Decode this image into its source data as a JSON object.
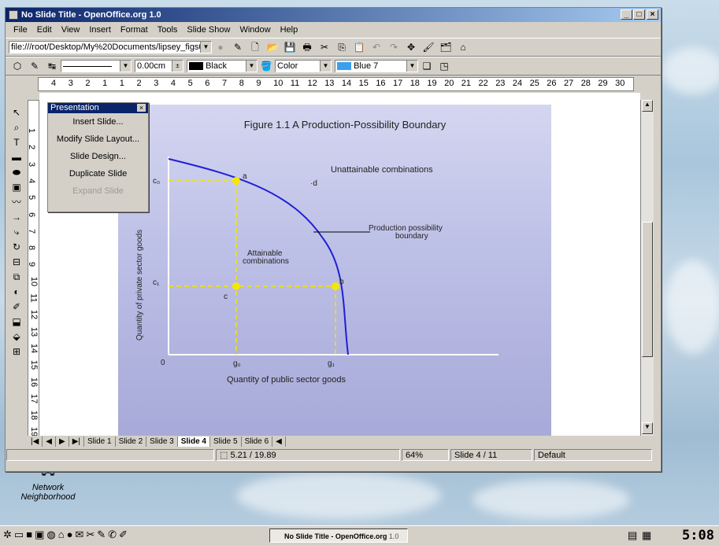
{
  "window": {
    "title": "No Slide Title - OpenOffice.org 1.0",
    "min": "_",
    "max": "□",
    "close": "×"
  },
  "menu": [
    "File",
    "Edit",
    "View",
    "Insert",
    "Format",
    "Tools",
    "Slide Show",
    "Window",
    "Help"
  ],
  "toolbar": {
    "url": "file:///root/Desktop/My%20Documents/lipsey_figs0"
  },
  "objectbar": {
    "line_width": "0.00cm",
    "line_color": "Black",
    "area_style": "Color",
    "area_color": "Blue 7"
  },
  "hruler_ticks": [
    "4",
    "3",
    "2",
    "1",
    "1",
    "2",
    "3",
    "4",
    "5",
    "6",
    "7",
    "8",
    "9",
    "10",
    "11",
    "12",
    "13",
    "14",
    "15",
    "16",
    "17",
    "18",
    "19",
    "20",
    "21",
    "22",
    "23",
    "24",
    "25",
    "26",
    "27",
    "28",
    "29",
    "30"
  ],
  "vruler_ticks": [
    "1",
    "2",
    "3",
    "4",
    "5",
    "6",
    "7",
    "8",
    "9",
    "10",
    "11",
    "12",
    "13",
    "14",
    "15",
    "16",
    "17",
    "18",
    "19"
  ],
  "panel": {
    "title": "Presentation",
    "close": "×",
    "items": [
      "Insert Slide...",
      "Modify Slide Layout...",
      "Slide Design...",
      "Duplicate Slide",
      "Expand Slide"
    ]
  },
  "figure": {
    "title": "Figure 1.1 A Production-Possibility Boundary",
    "ylabel": "Quantity of private sector goods",
    "xlabel": "Quantity of public sector goods",
    "origin": "0",
    "g0": "g₀",
    "g1": "g₁",
    "c0": "c₀",
    "c1": "c₁",
    "a": "a",
    "b": "b",
    "c": "c",
    "d": "·d",
    "unattainable": "Unattainable combinations",
    "attainable_line1": "Attainable",
    "attainable_line2": "combinations",
    "ppb_line1": "Production possibility",
    "ppb_line2": "boundary"
  },
  "tabs": [
    "Slide 1",
    "Slide 2",
    "Slide 3",
    "Slide 4",
    "Slide 5",
    "Slide 6"
  ],
  "active_tab": "Slide 4",
  "status": {
    "position": "5.21 / 19.89",
    "zoom": "64%",
    "slide": "Slide 4 / 11",
    "layout": "Default"
  },
  "desktop_icon": {
    "line1": "Network",
    "line2": "Neighborhood"
  },
  "taskbar": {
    "task": "No Slide Title - OpenOffice.org",
    "task_version": "1.0",
    "clock": "5:08"
  },
  "colors": {
    "curve": "#1f1fd6",
    "dashes": "#f2e600",
    "point": "#f5e800",
    "slide_top": "#d4d6f0",
    "slide_bottom": "#a7a9d8"
  }
}
